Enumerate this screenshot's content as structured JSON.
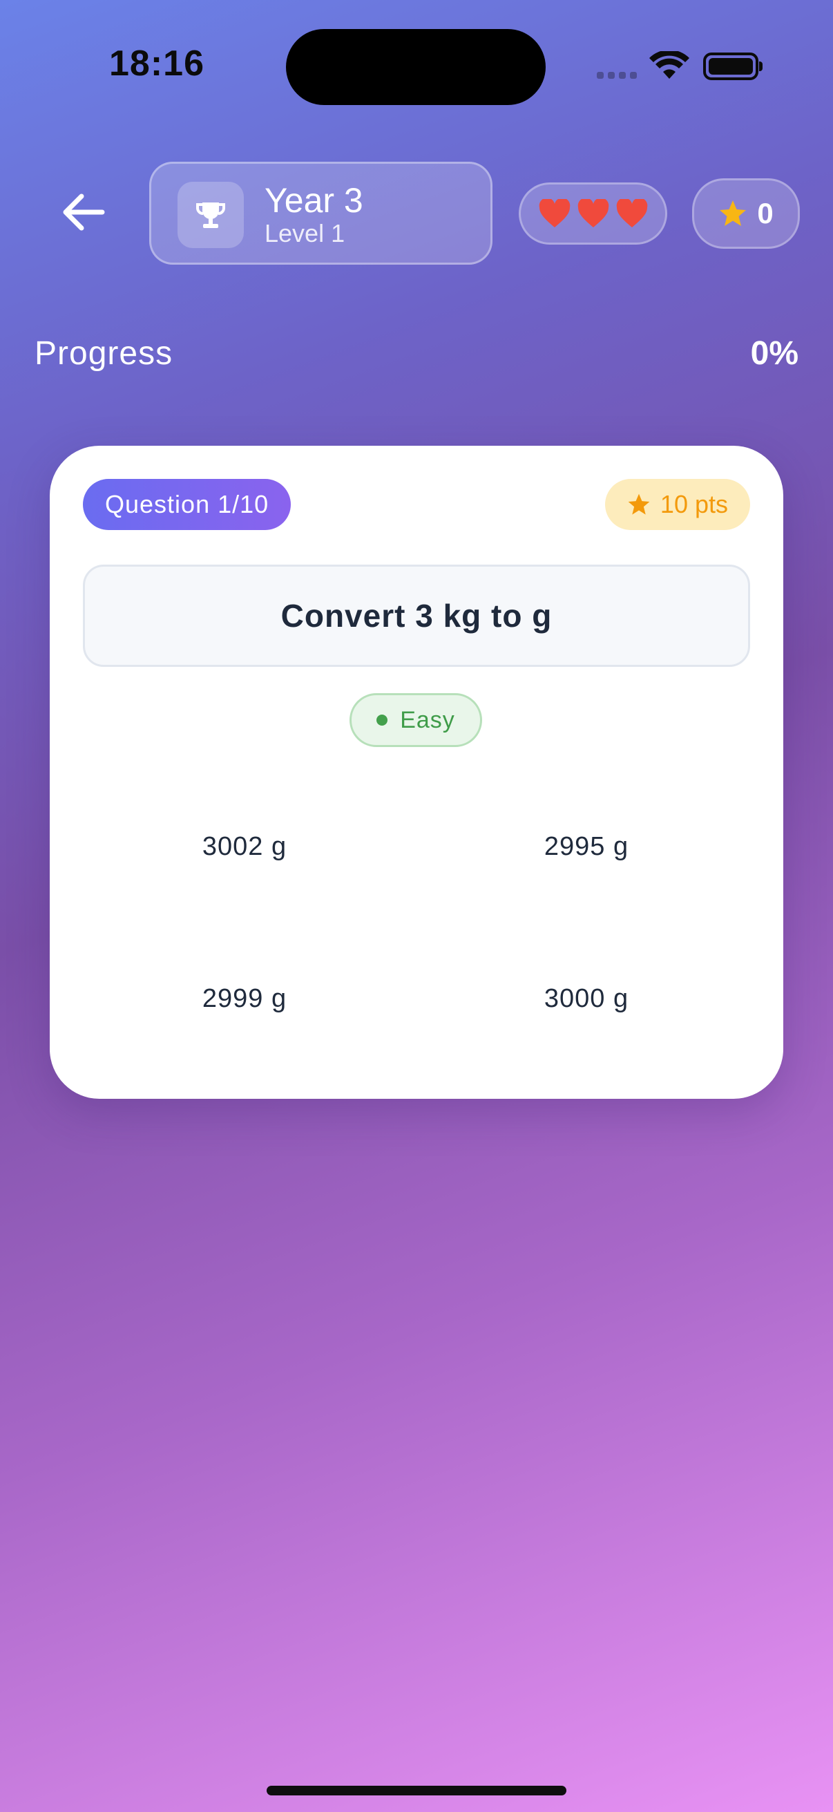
{
  "status_bar": {
    "time": "18:16"
  },
  "header": {
    "level_title": "Year 3",
    "level_subtitle": "Level 1",
    "lives": 3,
    "star_score": "0"
  },
  "progress": {
    "label": "Progress",
    "value": "0%"
  },
  "question_card": {
    "counter": "Question 1/10",
    "points": "10 pts",
    "question": "Convert 3 kg to g",
    "difficulty": "Easy",
    "options": [
      "3002 g",
      "2995 g",
      "2999 g",
      "3000 g"
    ]
  },
  "colors": {
    "accent": "#6a6cf0",
    "heart": "#f04a3c",
    "star": "#f8b614",
    "easy_green": "#43a04c"
  },
  "icons": {
    "back": "arrow-left-icon",
    "level": "trophy-icon",
    "lives": "heart-icon",
    "score": "star-icon"
  }
}
